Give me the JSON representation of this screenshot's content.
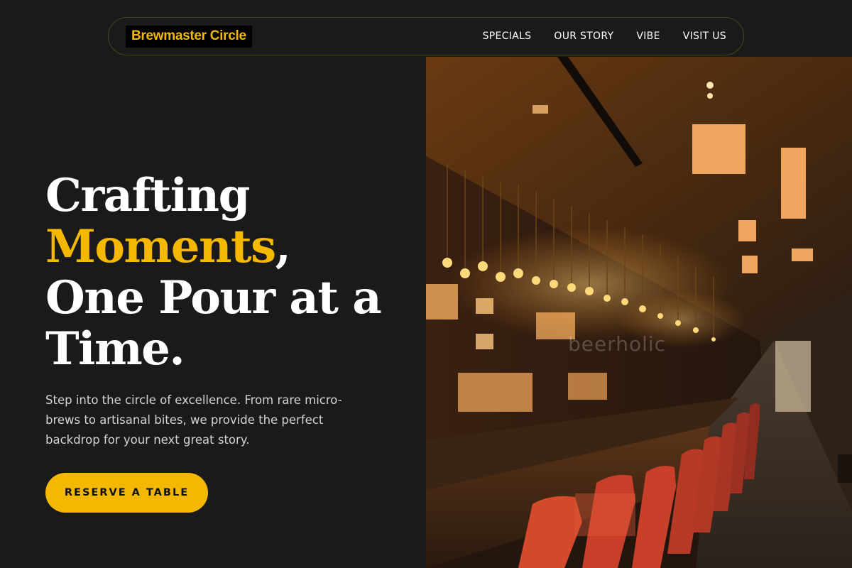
{
  "brand": {
    "name": "Brewmaster Circle"
  },
  "nav": {
    "links": [
      {
        "label": "SPECIALS"
      },
      {
        "label": "OUR STORY"
      },
      {
        "label": "VIBE"
      },
      {
        "label": "VISIT US"
      }
    ]
  },
  "hero": {
    "title_line1": "Crafting",
    "title_accent": "Moments",
    "title_comma": ",",
    "title_line3": "One Pour at a",
    "title_line4": "Time.",
    "subtitle": "Step into the circle of excellence. From rare micro-brews to artisanal bites, we provide the perfect backdrop for your next great story.",
    "cta_label": "RESERVE A TABLE",
    "image_watermark": "beerholic"
  },
  "colors": {
    "background": "#1a1a1a",
    "accent": "#f5b800",
    "text": "#ffffff",
    "muted_text": "#d4d4d4"
  }
}
